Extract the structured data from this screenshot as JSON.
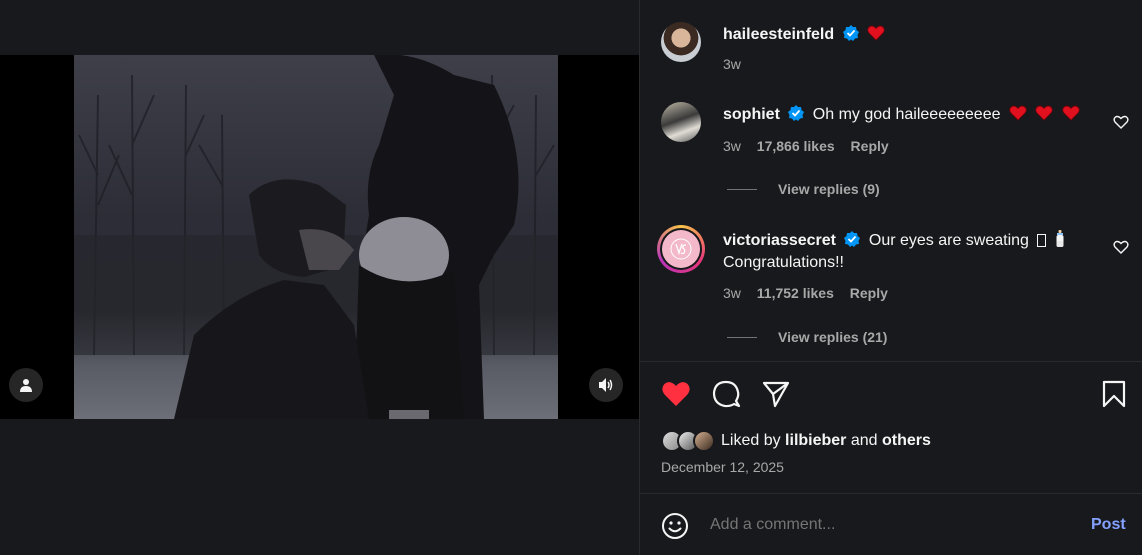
{
  "post": {
    "author": "haileesteinfeld",
    "time": "3w"
  },
  "comments": [
    {
      "username": "sophiet",
      "text": "Oh my god haileeeeeeeee",
      "time": "3w",
      "likes": "17,866 likes",
      "reply": "Reply",
      "view_replies": "View replies (9)"
    },
    {
      "username": "victoriassecret",
      "text_line1": "Our eyes are sweating",
      "text_line2": "Congratulations!!",
      "time": "3w",
      "likes": "11,752 likes",
      "reply": "Reply",
      "view_replies": "View replies (21)"
    }
  ],
  "actions": {
    "like_icon": "heart-filled-icon",
    "comment_icon": "comment-icon",
    "share_icon": "share-icon",
    "save_icon": "bookmark-icon"
  },
  "likes": {
    "prefix": "Liked by",
    "user": "lilbieber",
    "connector": "and",
    "others": "others"
  },
  "date": "December 12, 2025",
  "comment_box": {
    "placeholder": "Add a comment...",
    "post_label": "Post"
  },
  "colors": {
    "background": "#18191c",
    "like_red": "#ff3040",
    "verified_blue": "#0095f6",
    "link_blue": "#85a1ff",
    "muted": "#a8a8a8"
  }
}
